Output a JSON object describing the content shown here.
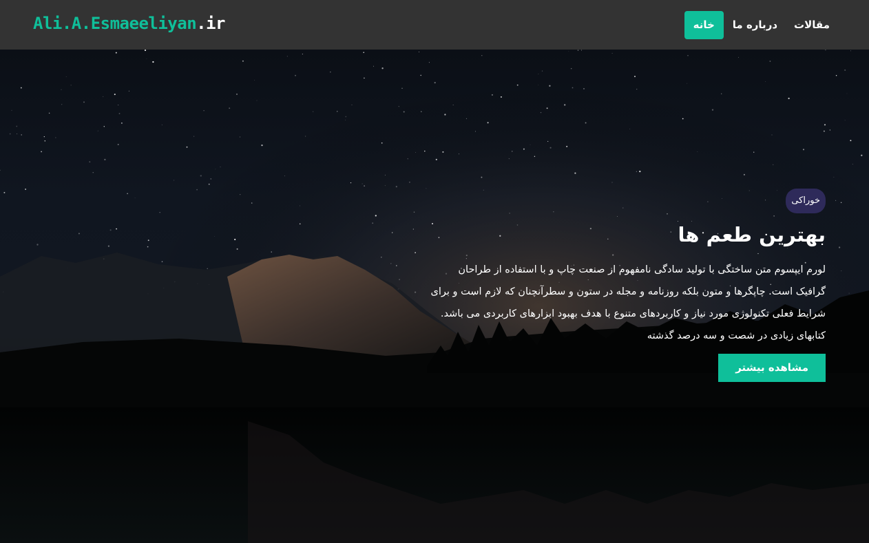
{
  "header": {
    "logo_main": "Ali.A.Esmaeeliyan",
    "logo_tld": ".ir",
    "nav": [
      {
        "label": "خانه",
        "active": true
      },
      {
        "label": "درباره ما",
        "active": false
      },
      {
        "label": "مقالات",
        "active": false
      }
    ]
  },
  "hero": {
    "badge": "خوراکی",
    "title": "بهترین طعم ها",
    "description": "لورم ایپسوم متن ساختگی با تولید سادگی نامفهوم از صنعت چاپ و با استفاده از طراحان گرافیک است. چاپگرها و متون بلکه روزنامه و مجله در ستون و سطرآنچنان که لازم است و برای شرایط فعلی تکنولوژی مورد نیاز و کاربردهای متنوع با هدف بهبود ابزارهای کاربردی می باشد. کتابهای زیادی در شصت و سه درصد گذشته",
    "button": "مشاهده بیشتر"
  },
  "colors": {
    "accent": "#0fbf9a",
    "navbar": "#333333",
    "badge": "#2e2a5a"
  }
}
